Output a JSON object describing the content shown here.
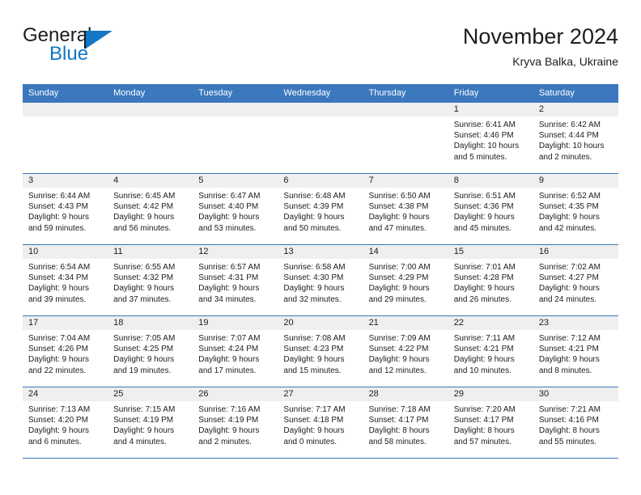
{
  "brand": {
    "word_general": "General",
    "word_blue": "Blue",
    "triangle_color": "#1277c4"
  },
  "header": {
    "title": "November 2024",
    "location": "Kryva Balka, Ukraine",
    "header_bg_color": "#3b78be",
    "grid_line_color": "#3b78be",
    "daynum_bar_color": "#efefef"
  },
  "weekday_headers": [
    "Sunday",
    "Monday",
    "Tuesday",
    "Wednesday",
    "Thursday",
    "Friday",
    "Saturday"
  ],
  "weeks": [
    [
      {
        "day": "",
        "sunrise": "",
        "sunset": "",
        "daylight1": "",
        "daylight2": "",
        "empty": true
      },
      {
        "day": "",
        "sunrise": "",
        "sunset": "",
        "daylight1": "",
        "daylight2": "",
        "empty": true
      },
      {
        "day": "",
        "sunrise": "",
        "sunset": "",
        "daylight1": "",
        "daylight2": "",
        "empty": true
      },
      {
        "day": "",
        "sunrise": "",
        "sunset": "",
        "daylight1": "",
        "daylight2": "",
        "empty": true
      },
      {
        "day": "",
        "sunrise": "",
        "sunset": "",
        "daylight1": "",
        "daylight2": "",
        "empty": true
      },
      {
        "day": "1",
        "sunrise": "Sunrise: 6:41 AM",
        "sunset": "Sunset: 4:46 PM",
        "daylight1": "Daylight: 10 hours",
        "daylight2": "and 5 minutes.",
        "empty": false
      },
      {
        "day": "2",
        "sunrise": "Sunrise: 6:42 AM",
        "sunset": "Sunset: 4:44 PM",
        "daylight1": "Daylight: 10 hours",
        "daylight2": "and 2 minutes.",
        "empty": false
      }
    ],
    [
      {
        "day": "3",
        "sunrise": "Sunrise: 6:44 AM",
        "sunset": "Sunset: 4:43 PM",
        "daylight1": "Daylight: 9 hours",
        "daylight2": "and 59 minutes.",
        "empty": false
      },
      {
        "day": "4",
        "sunrise": "Sunrise: 6:45 AM",
        "sunset": "Sunset: 4:42 PM",
        "daylight1": "Daylight: 9 hours",
        "daylight2": "and 56 minutes.",
        "empty": false
      },
      {
        "day": "5",
        "sunrise": "Sunrise: 6:47 AM",
        "sunset": "Sunset: 4:40 PM",
        "daylight1": "Daylight: 9 hours",
        "daylight2": "and 53 minutes.",
        "empty": false
      },
      {
        "day": "6",
        "sunrise": "Sunrise: 6:48 AM",
        "sunset": "Sunset: 4:39 PM",
        "daylight1": "Daylight: 9 hours",
        "daylight2": "and 50 minutes.",
        "empty": false
      },
      {
        "day": "7",
        "sunrise": "Sunrise: 6:50 AM",
        "sunset": "Sunset: 4:38 PM",
        "daylight1": "Daylight: 9 hours",
        "daylight2": "and 47 minutes.",
        "empty": false
      },
      {
        "day": "8",
        "sunrise": "Sunrise: 6:51 AM",
        "sunset": "Sunset: 4:36 PM",
        "daylight1": "Daylight: 9 hours",
        "daylight2": "and 45 minutes.",
        "empty": false
      },
      {
        "day": "9",
        "sunrise": "Sunrise: 6:52 AM",
        "sunset": "Sunset: 4:35 PM",
        "daylight1": "Daylight: 9 hours",
        "daylight2": "and 42 minutes.",
        "empty": false
      }
    ],
    [
      {
        "day": "10",
        "sunrise": "Sunrise: 6:54 AM",
        "sunset": "Sunset: 4:34 PM",
        "daylight1": "Daylight: 9 hours",
        "daylight2": "and 39 minutes.",
        "empty": false
      },
      {
        "day": "11",
        "sunrise": "Sunrise: 6:55 AM",
        "sunset": "Sunset: 4:32 PM",
        "daylight1": "Daylight: 9 hours",
        "daylight2": "and 37 minutes.",
        "empty": false
      },
      {
        "day": "12",
        "sunrise": "Sunrise: 6:57 AM",
        "sunset": "Sunset: 4:31 PM",
        "daylight1": "Daylight: 9 hours",
        "daylight2": "and 34 minutes.",
        "empty": false
      },
      {
        "day": "13",
        "sunrise": "Sunrise: 6:58 AM",
        "sunset": "Sunset: 4:30 PM",
        "daylight1": "Daylight: 9 hours",
        "daylight2": "and 32 minutes.",
        "empty": false
      },
      {
        "day": "14",
        "sunrise": "Sunrise: 7:00 AM",
        "sunset": "Sunset: 4:29 PM",
        "daylight1": "Daylight: 9 hours",
        "daylight2": "and 29 minutes.",
        "empty": false
      },
      {
        "day": "15",
        "sunrise": "Sunrise: 7:01 AM",
        "sunset": "Sunset: 4:28 PM",
        "daylight1": "Daylight: 9 hours",
        "daylight2": "and 26 minutes.",
        "empty": false
      },
      {
        "day": "16",
        "sunrise": "Sunrise: 7:02 AM",
        "sunset": "Sunset: 4:27 PM",
        "daylight1": "Daylight: 9 hours",
        "daylight2": "and 24 minutes.",
        "empty": false
      }
    ],
    [
      {
        "day": "17",
        "sunrise": "Sunrise: 7:04 AM",
        "sunset": "Sunset: 4:26 PM",
        "daylight1": "Daylight: 9 hours",
        "daylight2": "and 22 minutes.",
        "empty": false
      },
      {
        "day": "18",
        "sunrise": "Sunrise: 7:05 AM",
        "sunset": "Sunset: 4:25 PM",
        "daylight1": "Daylight: 9 hours",
        "daylight2": "and 19 minutes.",
        "empty": false
      },
      {
        "day": "19",
        "sunrise": "Sunrise: 7:07 AM",
        "sunset": "Sunset: 4:24 PM",
        "daylight1": "Daylight: 9 hours",
        "daylight2": "and 17 minutes.",
        "empty": false
      },
      {
        "day": "20",
        "sunrise": "Sunrise: 7:08 AM",
        "sunset": "Sunset: 4:23 PM",
        "daylight1": "Daylight: 9 hours",
        "daylight2": "and 15 minutes.",
        "empty": false
      },
      {
        "day": "21",
        "sunrise": "Sunrise: 7:09 AM",
        "sunset": "Sunset: 4:22 PM",
        "daylight1": "Daylight: 9 hours",
        "daylight2": "and 12 minutes.",
        "empty": false
      },
      {
        "day": "22",
        "sunrise": "Sunrise: 7:11 AM",
        "sunset": "Sunset: 4:21 PM",
        "daylight1": "Daylight: 9 hours",
        "daylight2": "and 10 minutes.",
        "empty": false
      },
      {
        "day": "23",
        "sunrise": "Sunrise: 7:12 AM",
        "sunset": "Sunset: 4:21 PM",
        "daylight1": "Daylight: 9 hours",
        "daylight2": "and 8 minutes.",
        "empty": false
      }
    ],
    [
      {
        "day": "24",
        "sunrise": "Sunrise: 7:13 AM",
        "sunset": "Sunset: 4:20 PM",
        "daylight1": "Daylight: 9 hours",
        "daylight2": "and 6 minutes.",
        "empty": false
      },
      {
        "day": "25",
        "sunrise": "Sunrise: 7:15 AM",
        "sunset": "Sunset: 4:19 PM",
        "daylight1": "Daylight: 9 hours",
        "daylight2": "and 4 minutes.",
        "empty": false
      },
      {
        "day": "26",
        "sunrise": "Sunrise: 7:16 AM",
        "sunset": "Sunset: 4:19 PM",
        "daylight1": "Daylight: 9 hours",
        "daylight2": "and 2 minutes.",
        "empty": false
      },
      {
        "day": "27",
        "sunrise": "Sunrise: 7:17 AM",
        "sunset": "Sunset: 4:18 PM",
        "daylight1": "Daylight: 9 hours",
        "daylight2": "and 0 minutes.",
        "empty": false
      },
      {
        "day": "28",
        "sunrise": "Sunrise: 7:18 AM",
        "sunset": "Sunset: 4:17 PM",
        "daylight1": "Daylight: 8 hours",
        "daylight2": "and 58 minutes.",
        "empty": false
      },
      {
        "day": "29",
        "sunrise": "Sunrise: 7:20 AM",
        "sunset": "Sunset: 4:17 PM",
        "daylight1": "Daylight: 8 hours",
        "daylight2": "and 57 minutes.",
        "empty": false
      },
      {
        "day": "30",
        "sunrise": "Sunrise: 7:21 AM",
        "sunset": "Sunset: 4:16 PM",
        "daylight1": "Daylight: 8 hours",
        "daylight2": "and 55 minutes.",
        "empty": false
      }
    ]
  ]
}
